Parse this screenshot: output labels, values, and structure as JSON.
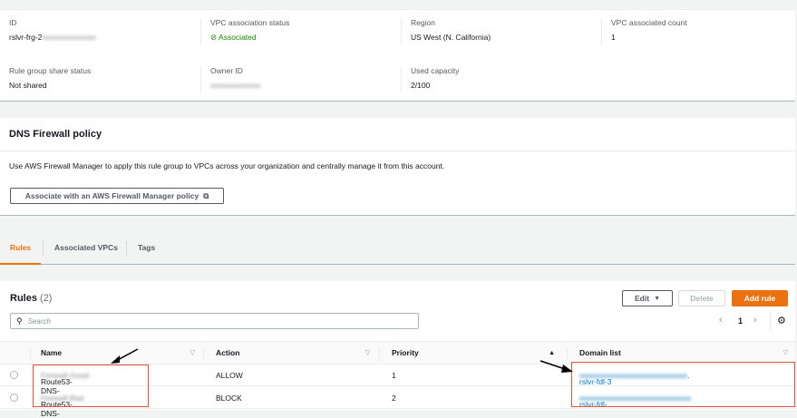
{
  "details": {
    "id": {
      "label": "ID",
      "value_prefix": "rslvr-frg-2"
    },
    "vpc_status": {
      "label": "VPC association status",
      "value": "Associated"
    },
    "region": {
      "label": "Region",
      "value": "US West (N. California)"
    },
    "vpc_count": {
      "label": "VPC associated count",
      "value": "1"
    },
    "share_status": {
      "label": "Rule group share status",
      "value": "Not shared"
    },
    "owner": {
      "label": "Owner ID"
    },
    "capacity": {
      "label": "Used capacity",
      "value": "2/100"
    }
  },
  "policy": {
    "title": "DNS Firewall policy",
    "description": "Use AWS Firewall Manager to apply this rule group to VPCs across your organization and centrally manage it from this account.",
    "button": "Associate with an AWS Firewall Manager policy"
  },
  "tabs": [
    {
      "label": "Rules"
    },
    {
      "label": "Associated VPCs"
    },
    {
      "label": "Tags"
    }
  ],
  "rules": {
    "title": "Rules",
    "count": "(2)",
    "edit": "Edit",
    "delete": "Delete",
    "add": "Add rule",
    "search_placeholder": "Search",
    "page": "1",
    "columns": [
      "Name",
      "Action",
      "Priority",
      "Domain list"
    ],
    "rows": [
      {
        "name_prefix": "Route53-DNS-",
        "action": "ALLOW",
        "priority": "1",
        "domain_prefix": "rslvr-fdl-3"
      },
      {
        "name_prefix": "Route53-DNS-",
        "action": "BLOCK",
        "priority": "2",
        "domain_prefix": "rslvr-fdl-"
      }
    ]
  }
}
